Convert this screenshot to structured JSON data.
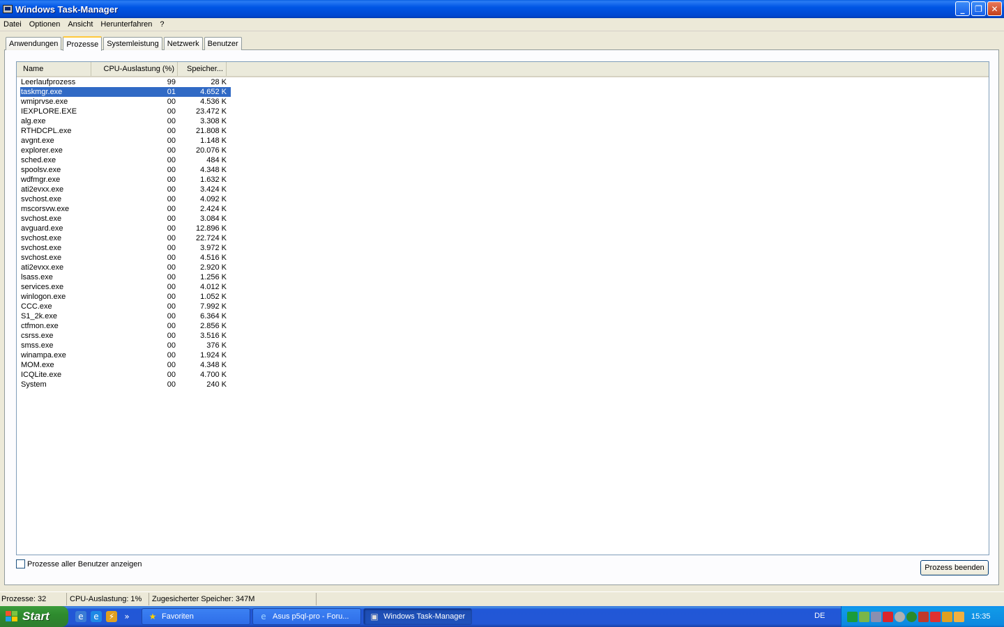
{
  "window": {
    "title": "Windows Task-Manager",
    "buttons": {
      "minimize": "_",
      "restore": "❐",
      "close": "✕"
    }
  },
  "menu": [
    "Datei",
    "Optionen",
    "Ansicht",
    "Herunterfahren",
    "?"
  ],
  "tabs": [
    "Anwendungen",
    "Prozesse",
    "Systemleistung",
    "Netzwerk",
    "Benutzer"
  ],
  "active_tab": "Prozesse",
  "columns": {
    "name": "Name",
    "cpu": "CPU-Auslastung (%)",
    "mem": "Speicher..."
  },
  "processes": [
    {
      "name": "Leerlaufprozess",
      "cpu": "99",
      "mem": "28 K"
    },
    {
      "name": "taskmgr.exe",
      "cpu": "01",
      "mem": "4.652 K",
      "selected": true
    },
    {
      "name": "wmiprvse.exe",
      "cpu": "00",
      "mem": "4.536 K"
    },
    {
      "name": "IEXPLORE.EXE",
      "cpu": "00",
      "mem": "23.472 K"
    },
    {
      "name": "alg.exe",
      "cpu": "00",
      "mem": "3.308 K"
    },
    {
      "name": "RTHDCPL.exe",
      "cpu": "00",
      "mem": "21.808 K"
    },
    {
      "name": "avgnt.exe",
      "cpu": "00",
      "mem": "1.148 K"
    },
    {
      "name": "explorer.exe",
      "cpu": "00",
      "mem": "20.076 K"
    },
    {
      "name": "sched.exe",
      "cpu": "00",
      "mem": "484 K"
    },
    {
      "name": "spoolsv.exe",
      "cpu": "00",
      "mem": "4.348 K"
    },
    {
      "name": "wdfmgr.exe",
      "cpu": "00",
      "mem": "1.632 K"
    },
    {
      "name": "ati2evxx.exe",
      "cpu": "00",
      "mem": "3.424 K"
    },
    {
      "name": "svchost.exe",
      "cpu": "00",
      "mem": "4.092 K"
    },
    {
      "name": "mscorsvw.exe",
      "cpu": "00",
      "mem": "2.424 K"
    },
    {
      "name": "svchost.exe",
      "cpu": "00",
      "mem": "3.084 K"
    },
    {
      "name": "avguard.exe",
      "cpu": "00",
      "mem": "12.896 K"
    },
    {
      "name": "svchost.exe",
      "cpu": "00",
      "mem": "22.724 K"
    },
    {
      "name": "svchost.exe",
      "cpu": "00",
      "mem": "3.972 K"
    },
    {
      "name": "svchost.exe",
      "cpu": "00",
      "mem": "4.516 K"
    },
    {
      "name": "ati2evxx.exe",
      "cpu": "00",
      "mem": "2.920 K"
    },
    {
      "name": "lsass.exe",
      "cpu": "00",
      "mem": "1.256 K"
    },
    {
      "name": "services.exe",
      "cpu": "00",
      "mem": "4.012 K"
    },
    {
      "name": "winlogon.exe",
      "cpu": "00",
      "mem": "1.052 K"
    },
    {
      "name": "CCC.exe",
      "cpu": "00",
      "mem": "7.992 K"
    },
    {
      "name": "S1_2k.exe",
      "cpu": "00",
      "mem": "6.364 K"
    },
    {
      "name": "ctfmon.exe",
      "cpu": "00",
      "mem": "2.856 K"
    },
    {
      "name": "csrss.exe",
      "cpu": "00",
      "mem": "3.516 K"
    },
    {
      "name": "smss.exe",
      "cpu": "00",
      "mem": "376 K"
    },
    {
      "name": "winampa.exe",
      "cpu": "00",
      "mem": "1.924 K"
    },
    {
      "name": "MOM.exe",
      "cpu": "00",
      "mem": "4.348 K"
    },
    {
      "name": "ICQLite.exe",
      "cpu": "00",
      "mem": "4.700 K"
    },
    {
      "name": "System",
      "cpu": "00",
      "mem": "240 K"
    }
  ],
  "show_all_users": {
    "label": "Prozesse aller Benutzer anzeigen",
    "checked": false
  },
  "end_process_button": "Prozess beenden",
  "status": {
    "processes": "Prozesse: 32",
    "cpu": "CPU-Auslastung: 1%",
    "memory": "Zugesicherter Speicher: 347M"
  },
  "taskbar": {
    "start": "Start",
    "quicklaunch_more": "»",
    "tasks": [
      {
        "label": "Favoriten",
        "icon": "star-icon"
      },
      {
        "label": "Asus p5ql-pro - Foru...",
        "icon": "ie-icon"
      },
      {
        "label": "Windows Task-Manager",
        "icon": "taskmgr-icon",
        "active": true
      }
    ],
    "language": "DE",
    "clock": "15:35"
  },
  "colors": {
    "selection": "#316ac5",
    "titlebar": "#0055e5",
    "taskbar": "#2257d5",
    "start": "#2e8b2e"
  }
}
